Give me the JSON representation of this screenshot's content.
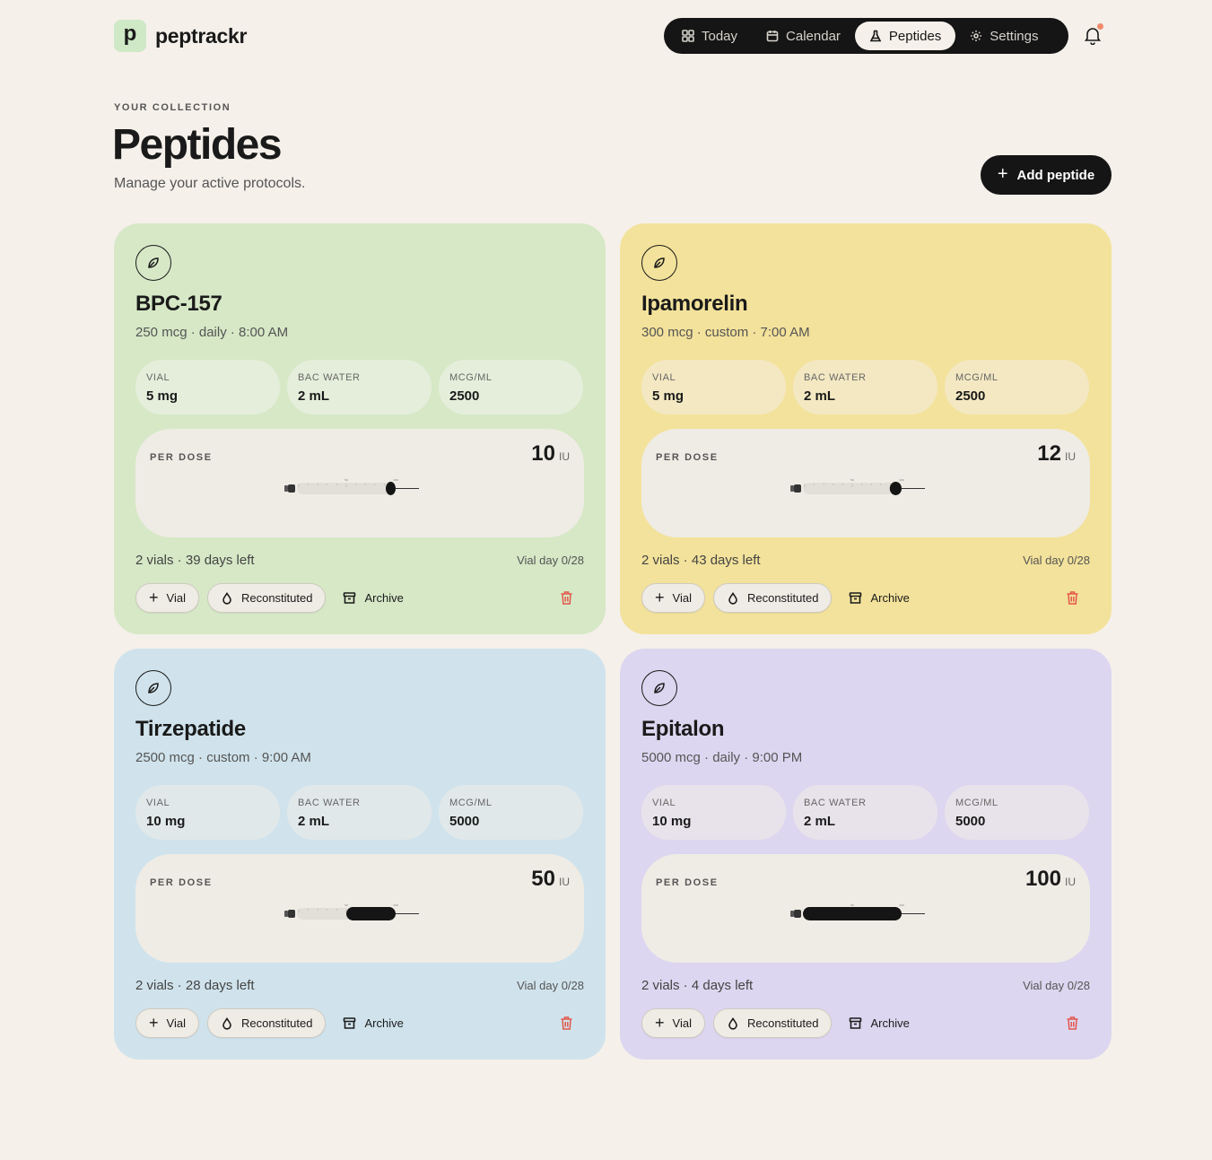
{
  "brand": {
    "mark": "p",
    "name": "peptrackr",
    "mark_color": "#cfe8c6"
  },
  "nav": [
    {
      "label": "Today",
      "icon": "grid-icon",
      "active": false
    },
    {
      "label": "Calendar",
      "icon": "calendar-icon",
      "active": false
    },
    {
      "label": "Peptides",
      "icon": "flask-icon",
      "active": true
    },
    {
      "label": "Settings",
      "icon": "gear-icon",
      "active": false
    }
  ],
  "notifications": {
    "icon": "bell-icon",
    "has_unread": true,
    "dot_color": "#f08a6b"
  },
  "header": {
    "eyebrow": "YOUR COLLECTION",
    "title": "Peptides",
    "subtitle": "Manage your active protocols.",
    "add_button": "Add peptide"
  },
  "labels": {
    "vial": "VIAL",
    "bac_water": "BAC WATER",
    "mcg_ml": "MCG/ML",
    "per_dose": "PER DOSE",
    "unit": "IU",
    "add_vial": "Vial",
    "reconstituted": "Reconstituted",
    "archive": "Archive"
  },
  "peptides": [
    {
      "name": "BPC-157",
      "meta": "250 mcg · daily · 8:00 AM",
      "vial": "5 mg",
      "bac_water": "2 mL",
      "mcg_ml": "2500",
      "dose": "10",
      "dose_fraction": 0.1,
      "vials_left": "2 vials · 39 days left",
      "vial_day": "Vial day 0/28",
      "bg": "#d6e8c6",
      "stat_bg": "#e5eedb"
    },
    {
      "name": "Ipamorelin",
      "meta": "300 mcg · custom · 7:00 AM",
      "vial": "5 mg",
      "bac_water": "2 mL",
      "mcg_ml": "2500",
      "dose": "12",
      "dose_fraction": 0.12,
      "vials_left": "2 vials · 43 days left",
      "vial_day": "Vial day 0/28",
      "bg": "#f3e29b",
      "stat_bg": "#f3e8c2"
    },
    {
      "name": "Tirzepatide",
      "meta": "2500 mcg · custom · 9:00 AM",
      "vial": "10 mg",
      "bac_water": "2 mL",
      "mcg_ml": "5000",
      "dose": "50",
      "dose_fraction": 0.5,
      "vials_left": "2 vials · 28 days left",
      "vial_day": "Vial day 0/28",
      "bg": "#d0e3ec",
      "stat_bg": "#e1e8ea"
    },
    {
      "name": "Epitalon",
      "meta": "5000 mcg · daily · 9:00 PM",
      "vial": "10 mg",
      "bac_water": "2 mL",
      "mcg_ml": "5000",
      "dose": "100",
      "dose_fraction": 1.0,
      "vials_left": "2 vials · 4 days left",
      "vial_day": "Vial day 0/28",
      "bg": "#ddd6f0",
      "stat_bg": "#e8e3ea"
    }
  ]
}
